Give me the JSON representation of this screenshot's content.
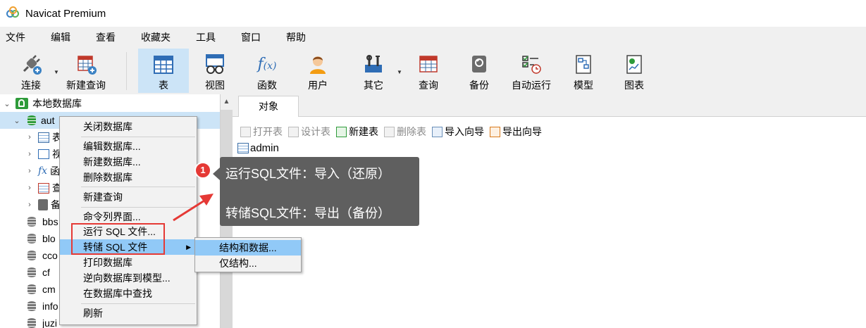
{
  "window": {
    "title": "Navicat Premium"
  },
  "menubar": [
    "文件",
    "编辑",
    "查看",
    "收藏夹",
    "工具",
    "窗口",
    "帮助"
  ],
  "toolbar": [
    {
      "label": "连接",
      "icon": "plug-icon"
    },
    {
      "label": "新建查询",
      "icon": "new-query-icon"
    },
    {
      "label": "表",
      "icon": "table-icon",
      "active": true
    },
    {
      "label": "视图",
      "icon": "view-icon"
    },
    {
      "label": "函数",
      "icon": "function-icon"
    },
    {
      "label": "用户",
      "icon": "user-icon"
    },
    {
      "label": "其它",
      "icon": "tools-icon"
    },
    {
      "label": "查询",
      "icon": "query-icon"
    },
    {
      "label": "备份",
      "icon": "backup-icon"
    },
    {
      "label": "自动运行",
      "icon": "schedule-icon"
    },
    {
      "label": "模型",
      "icon": "model-icon"
    },
    {
      "label": "图表",
      "icon": "chart-icon"
    }
  ],
  "tree": {
    "connection": "本地数据库",
    "selected_db": "aut",
    "child_labels": [
      "表",
      "视",
      "函",
      "查",
      "备"
    ],
    "databases": [
      "bbs",
      "blo",
      "cco",
      "cf",
      "cm",
      "info",
      "juzi"
    ]
  },
  "context_menu": {
    "items": [
      "关闭数据库",
      "编辑数据库...",
      "新建数据库...",
      "删除数据库",
      "新建查询",
      "命令列界面...",
      "运行 SQL 文件...",
      "转储 SQL 文件",
      "打印数据库",
      "逆向数据库到模型...",
      "在数据库中查找",
      "刷新"
    ],
    "highlighted": "转储 SQL 文件"
  },
  "submenu": {
    "items": [
      "结构和数据...",
      "仅结构..."
    ],
    "highlighted": "结构和数据..."
  },
  "right_panel": {
    "tab": "对象",
    "toolbar": [
      {
        "label": "打开表",
        "enabled": false
      },
      {
        "label": "设计表",
        "enabled": false
      },
      {
        "label": "新建表",
        "enabled": true
      },
      {
        "label": "删除表",
        "enabled": false
      },
      {
        "label": "导入向导",
        "enabled": true
      },
      {
        "label": "导出向导",
        "enabled": true
      }
    ],
    "objects": [
      "admin"
    ]
  },
  "annotation": {
    "badge": "1",
    "line1": "运行SQL文件：导入（还原）",
    "line2": "转储SQL文件：导出（备份）"
  },
  "colors": {
    "highlight": "#91c9f7",
    "active_tool": "#cce4f7",
    "annotation_red": "#e53935",
    "tooltip_bg": "#5f5f5f"
  }
}
